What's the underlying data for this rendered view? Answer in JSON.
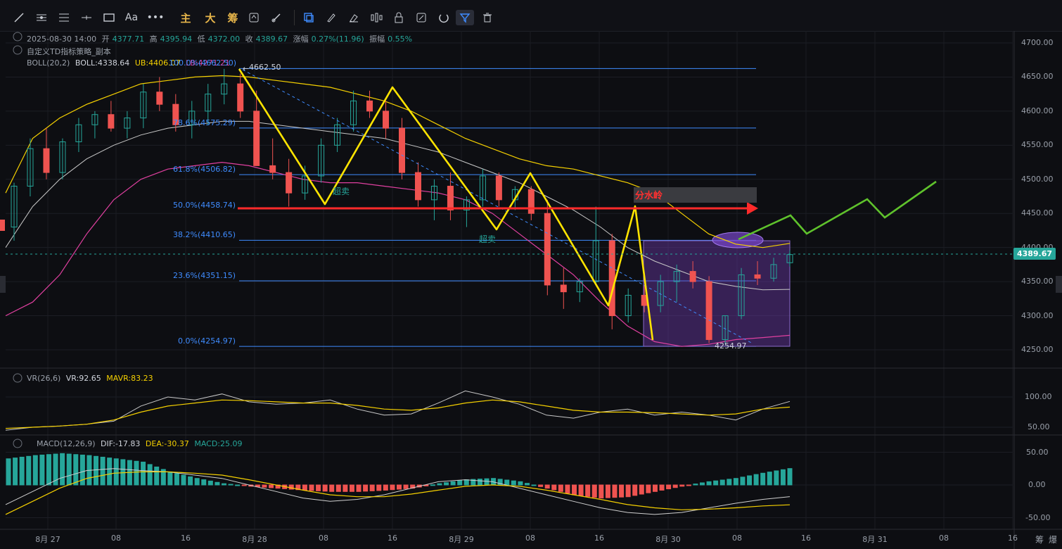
{
  "toolbar": {
    "items": [
      "trend-line",
      "ruler-h",
      "ruler-lines",
      "crosshair",
      "rect",
      "text",
      "more",
      "main",
      "big",
      "chips",
      "sync",
      "brush",
      "layers",
      "pencil",
      "marker",
      "candles",
      "lock",
      "plan",
      "magnet",
      "filter",
      "trash"
    ],
    "labels": {
      "text": "Aa",
      "more": "•••",
      "main": "主",
      "big": "大",
      "chips": "筹"
    }
  },
  "header": {
    "datetime": "2025-08-30 14:00",
    "open_label": "开",
    "open": "4377.71",
    "high_label": "高",
    "high": "4395.94",
    "low_label": "低",
    "low": "4372.00",
    "close_label": "收",
    "close": "4389.67",
    "change_label": "涨幅",
    "change": "0.27%(11.96)",
    "amplitude_label": "振幅",
    "amplitude": "0.55%",
    "strategy": "自定义TD指标策略_副本"
  },
  "boll": {
    "label": "BOLL(20,2)",
    "mid": "BOLL:4338.64",
    "ub": "UB:4406.07",
    "lb": "LB:4271.21"
  },
  "vr": {
    "label": "VR(26,6)",
    "vr": "VR:92.65",
    "mavr": "MAVR:83.23"
  },
  "macd": {
    "label": "MACD(12,26,9)",
    "dif": "DIF:-17.83",
    "dea": "DEA:-30.37",
    "macd": "MACD:25.09"
  },
  "fib_levels": [
    {
      "label": "100.0%(4662.50)",
      "value": 4662.5
    },
    {
      "label": "78.6%(4575.29)",
      "value": 4575.29
    },
    {
      "label": "61.8%(4506.82)",
      "value": 4506.82
    },
    {
      "label": "50.0%(4458.74)",
      "value": 4458.74
    },
    {
      "label": "38.2%(4410.65)",
      "value": 4410.65
    },
    {
      "label": "23.6%(4351.15)",
      "value": 4351.15
    },
    {
      "label": "0.0%(4254.97)",
      "value": 4254.97
    }
  ],
  "annotations": {
    "high_price": "4662.50",
    "low_price": "4254.97",
    "oversold_1": "超卖",
    "oversold_2": "超卖",
    "watershed": "分水岭"
  },
  "last_price": "4389.67",
  "corner": {
    "chips": "筹",
    "burst": "爆"
  },
  "colors": {
    "up": "#26a69a",
    "down": "#ef5350",
    "boll_upper": "#f5d000",
    "boll_mid": "#c8c8c8",
    "boll_lower": "#e040a0",
    "fib": "#3f8cff",
    "zigzag": "#ffe400",
    "watershed_line": "#ff2a2a",
    "projection": "#5fc22c",
    "box": "#6a3aa8"
  },
  "chart_data": {
    "type": "candlestick",
    "main_yaxis": {
      "ylim": [
        4240,
        4710
      ],
      "ticks": [
        4700,
        4650,
        4600,
        4550,
        4500,
        4450,
        4400,
        4350,
        4300,
        4250
      ]
    },
    "vr_yaxis": {
      "ticks": [
        100,
        50
      ]
    },
    "macd_yaxis": {
      "ticks": [
        50,
        0,
        -50
      ]
    },
    "x_ticks": [
      "8月 27",
      "08",
      "16",
      "8月 28",
      "08",
      "16",
      "8月 29",
      "08",
      "16",
      "8月 30",
      "08",
      "16",
      "8月 31",
      "08",
      "16"
    ],
    "candles": [
      [
        4430,
        4495,
        4410,
        4490
      ],
      [
        4490,
        4560,
        4475,
        4545
      ],
      [
        4545,
        4575,
        4500,
        4510
      ],
      [
        4510,
        4560,
        4500,
        4555
      ],
      [
        4555,
        4590,
        4540,
        4580
      ],
      [
        4580,
        4600,
        4560,
        4595
      ],
      [
        4595,
        4615,
        4570,
        4575
      ],
      [
        4575,
        4600,
        4560,
        4590
      ],
      [
        4590,
        4640,
        4575,
        4628
      ],
      [
        4628,
        4650,
        4600,
        4610
      ],
      [
        4610,
        4625,
        4570,
        4580
      ],
      [
        4580,
        4615,
        4560,
        4600
      ],
      [
        4600,
        4640,
        4580,
        4625
      ],
      [
        4625,
        4662,
        4610,
        4640
      ],
      [
        4640,
        4655,
        4590,
        4600
      ],
      [
        4600,
        4630,
        4550,
        4520
      ],
      [
        4520,
        4560,
        4500,
        4510
      ],
      [
        4510,
        4530,
        4460,
        4480
      ],
      [
        4480,
        4520,
        4470,
        4505
      ],
      [
        4505,
        4560,
        4495,
        4550
      ],
      [
        4550,
        4590,
        4540,
        4580
      ],
      [
        4580,
        4630,
        4570,
        4615
      ],
      [
        4615,
        4630,
        4590,
        4600
      ],
      [
        4600,
        4615,
        4560,
        4575
      ],
      [
        4575,
        4590,
        4500,
        4510
      ],
      [
        4510,
        4525,
        4460,
        4470
      ],
      [
        4470,
        4500,
        4440,
        4490
      ],
      [
        4490,
        4510,
        4440,
        4455
      ],
      [
        4455,
        4475,
        4430,
        4470
      ],
      [
        4470,
        4515,
        4460,
        4505
      ],
      [
        4505,
        4510,
        4460,
        4470
      ],
      [
        4470,
        4490,
        4455,
        4485
      ],
      [
        4485,
        4490,
        4440,
        4450
      ],
      [
        4450,
        4470,
        4330,
        4345
      ],
      [
        4345,
        4370,
        4310,
        4335
      ],
      [
        4335,
        4355,
        4320,
        4350
      ],
      [
        4350,
        4460,
        4345,
        4410
      ],
      [
        4410,
        4420,
        4280,
        4300
      ],
      [
        4300,
        4340,
        4290,
        4330
      ],
      [
        4330,
        4345,
        4305,
        4315
      ],
      [
        4315,
        4360,
        4305,
        4350
      ],
      [
        4350,
        4375,
        4320,
        4365
      ],
      [
        4365,
        4380,
        4340,
        4350
      ],
      [
        4350,
        4358,
        4260,
        4265
      ],
      [
        4265,
        4300,
        4258,
        4300
      ],
      [
        4300,
        4370,
        4295,
        4360
      ],
      [
        4360,
        4380,
        4345,
        4355
      ],
      [
        4355,
        4385,
        4350,
        4375
      ],
      [
        4377.71,
        4395.94,
        4372.0,
        4389.67
      ]
    ],
    "boll_upper": [
      4480,
      4560,
      4590,
      4610,
      4625,
      4640,
      4645,
      4650,
      4652,
      4650,
      4645,
      4640,
      4635,
      4625,
      4615,
      4600,
      4580,
      4560,
      4545,
      4530,
      4520,
      4515,
      4505,
      4495,
      4480,
      4450,
      4420,
      4405,
      4400,
      4406.07
    ],
    "boll_mid": [
      4400,
      4460,
      4500,
      4530,
      4550,
      4565,
      4575,
      4580,
      4585,
      4585,
      4580,
      4575,
      4570,
      4565,
      4560,
      4550,
      4540,
      4525,
      4510,
      4495,
      4475,
      4455,
      4430,
      4400,
      4380,
      4365,
      4350,
      4343,
      4338,
      4338.64
    ],
    "boll_lower": [
      4300,
      4320,
      4360,
      4420,
      4470,
      4500,
      4515,
      4520,
      4525,
      4520,
      4510,
      4500,
      4495,
      4495,
      4490,
      4485,
      4480,
      4470,
      4450,
      4420,
      4390,
      4360,
      4320,
      4285,
      4262,
      4255,
      4258,
      4265,
      4268,
      4271.21
    ],
    "zigzag": [
      [
        4662.5,
        "high"
      ],
      [
        4465,
        "low"
      ],
      [
        4632,
        "high"
      ],
      [
        4458,
        "low"
      ],
      [
        4513,
        "high"
      ],
      [
        4426,
        "low"
      ],
      [
        4513,
        "high"
      ],
      [
        4315,
        "low"
      ],
      [
        4456,
        "high"
      ],
      [
        4265,
        "low"
      ]
    ],
    "projection": [
      4410,
      4450,
      4420,
      4470,
      4445,
      4490
    ],
    "vr_series": [
      45,
      50,
      52,
      55,
      60,
      85,
      100,
      95,
      105,
      92,
      88,
      90,
      95,
      80,
      70,
      72,
      90,
      110,
      100,
      88,
      70,
      65,
      75,
      80,
      70,
      75,
      70,
      62,
      80,
      92.65
    ],
    "mavr_series": [
      48,
      50,
      52,
      55,
      62,
      75,
      85,
      90,
      95,
      94,
      92,
      90,
      90,
      86,
      80,
      78,
      82,
      90,
      95,
      92,
      85,
      78,
      75,
      75,
      74,
      72,
      70,
      72,
      80,
      83.23
    ],
    "macd_hist": [
      40,
      45,
      48,
      45,
      40,
      35,
      20,
      10,
      2,
      -2,
      -5,
      -8,
      -10,
      -10,
      -8,
      -5,
      2,
      8,
      10,
      5,
      -5,
      -15,
      -20,
      -18,
      -10,
      -2,
      5,
      10,
      18,
      25.09
    ],
    "dif_series": [
      -30,
      -10,
      10,
      22,
      25,
      22,
      20,
      15,
      10,
      0,
      -10,
      -20,
      -25,
      -22,
      -15,
      -5,
      5,
      8,
      5,
      -5,
      -15,
      -25,
      -35,
      -42,
      -45,
      -42,
      -35,
      -28,
      -22,
      -17.83
    ],
    "dea_series": [
      -45,
      -25,
      -5,
      10,
      18,
      20,
      20,
      18,
      15,
      8,
      0,
      -8,
      -15,
      -18,
      -18,
      -14,
      -8,
      -2,
      0,
      -2,
      -8,
      -15,
      -22,
      -30,
      -35,
      -38,
      -37,
      -35,
      -32,
      -30.37
    ]
  }
}
